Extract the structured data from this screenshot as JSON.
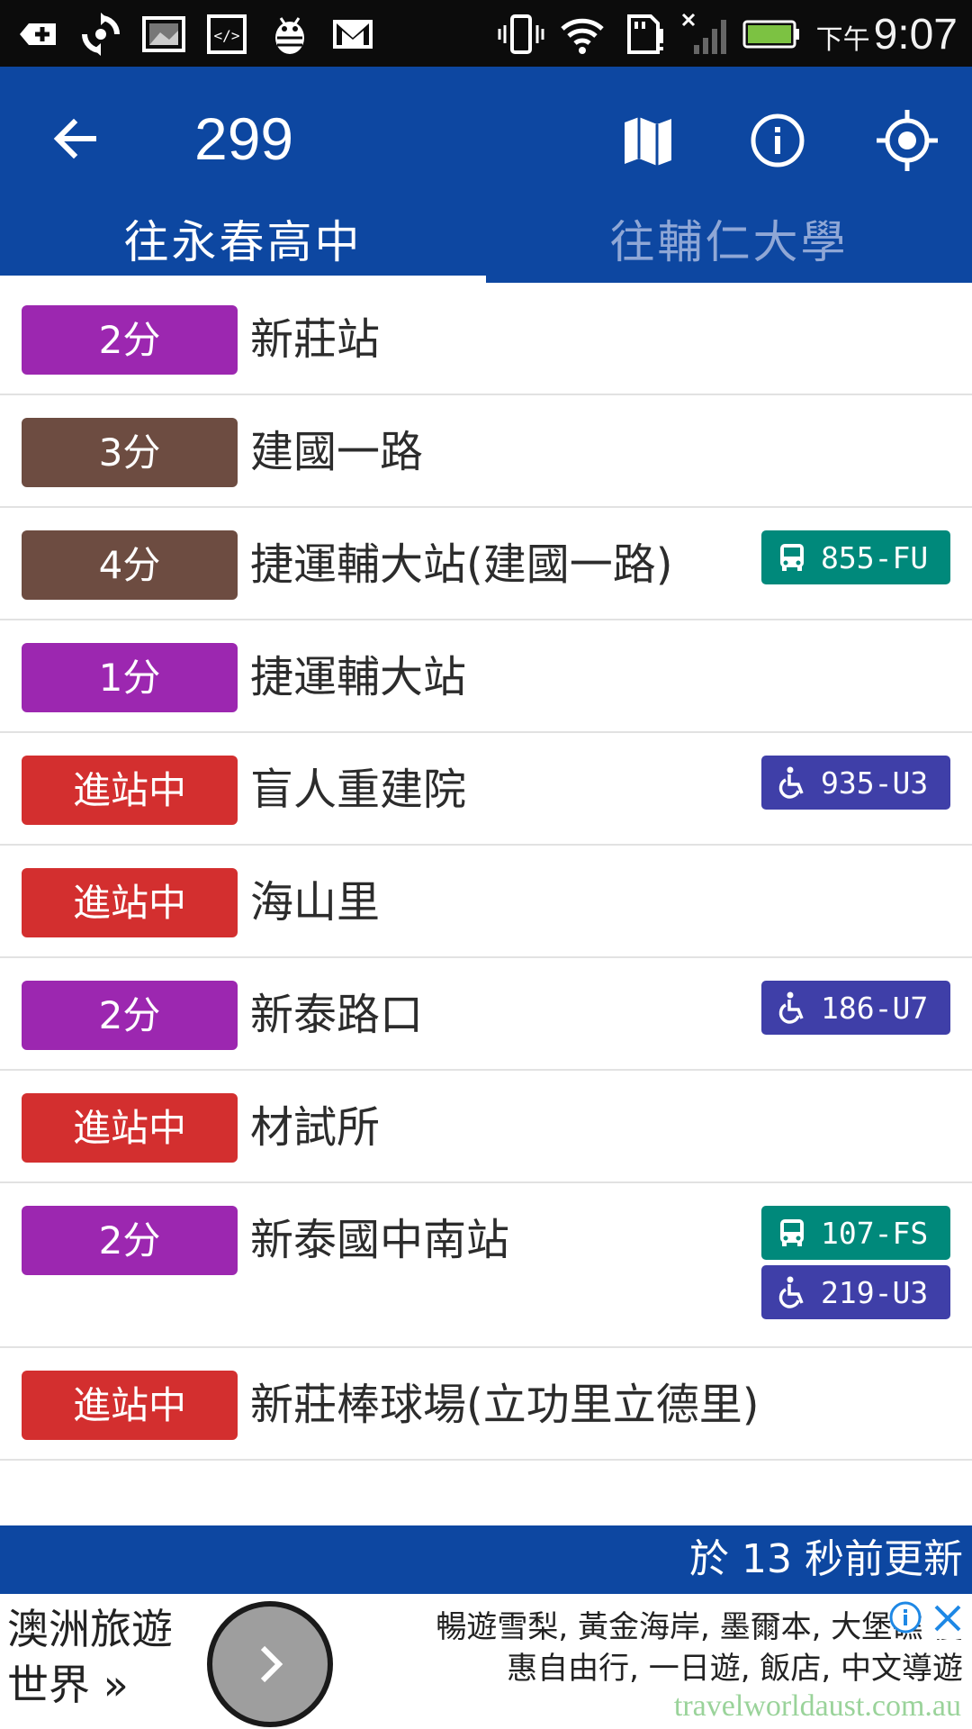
{
  "status_bar": {
    "left_icons": [
      "add-box-icon",
      "sync-icon",
      "image-icon",
      "code-icon",
      "android-bug-icon",
      "gmail-icon"
    ],
    "right_icons": [
      "vibrate-icon",
      "wifi-icon",
      "sd-card-alert-icon",
      "signal-off-icon",
      "battery-icon"
    ],
    "ampm": "下午",
    "time": "9:07"
  },
  "app_bar": {
    "title": "299",
    "actions": [
      "map-icon",
      "info-icon",
      "gps-location-icon"
    ],
    "tabs": [
      {
        "label": "往永春高中",
        "active": true
      },
      {
        "label": "往輔仁大學",
        "active": false
      }
    ],
    "colors": {
      "primary": "#0d47a1",
      "inactive_tab_text": "#8fa7d6"
    }
  },
  "stops": [
    {
      "eta": "2分",
      "color": "#9c27b0",
      "name": "新莊站",
      "buses": []
    },
    {
      "eta": "3分",
      "color": "#6d4c41",
      "name": "建國一路",
      "buses": []
    },
    {
      "eta": "4分",
      "color": "#6d4c41",
      "name": "捷運輔大站(建國一路)",
      "buses": [
        {
          "plate": "855-FU",
          "kind": "bus",
          "color": "#00897b"
        }
      ]
    },
    {
      "eta": "1分",
      "color": "#9c27b0",
      "name": "捷運輔大站",
      "buses": []
    },
    {
      "eta": "進站中",
      "color": "#d32f2f",
      "name": "盲人重建院",
      "buses": [
        {
          "plate": "935-U3",
          "kind": "accessible",
          "color": "#3f3fa8"
        }
      ]
    },
    {
      "eta": "進站中",
      "color": "#d32f2f",
      "name": "海山里",
      "buses": []
    },
    {
      "eta": "2分",
      "color": "#9c27b0",
      "name": "新泰路口",
      "buses": [
        {
          "plate": "186-U7",
          "kind": "accessible",
          "color": "#3f3fa8"
        }
      ]
    },
    {
      "eta": "進站中",
      "color": "#d32f2f",
      "name": "材試所",
      "buses": []
    },
    {
      "eta": "2分",
      "color": "#9c27b0",
      "name": "新泰國中南站",
      "buses": [
        {
          "plate": "107-FS",
          "kind": "bus",
          "color": "#00897b"
        },
        {
          "plate": "219-U3",
          "kind": "accessible",
          "color": "#3f3fa8"
        }
      ]
    },
    {
      "eta": "進站中",
      "color": "#d32f2f",
      "name": "新莊棒球場(立功里立德里)",
      "buses": []
    }
  ],
  "update_bar": {
    "text": "於 13 秒前更新"
  },
  "ad": {
    "title_line1": "澳洲旅遊",
    "title_line2": "世界 »",
    "text_line1": "暢遊雪梨, 黃金海岸, 墨爾本, 大堡礁 優",
    "text_line2": "惠自由行, 一日遊, 飯店, 中文導遊",
    "url": "travelworldaust.com.au"
  }
}
